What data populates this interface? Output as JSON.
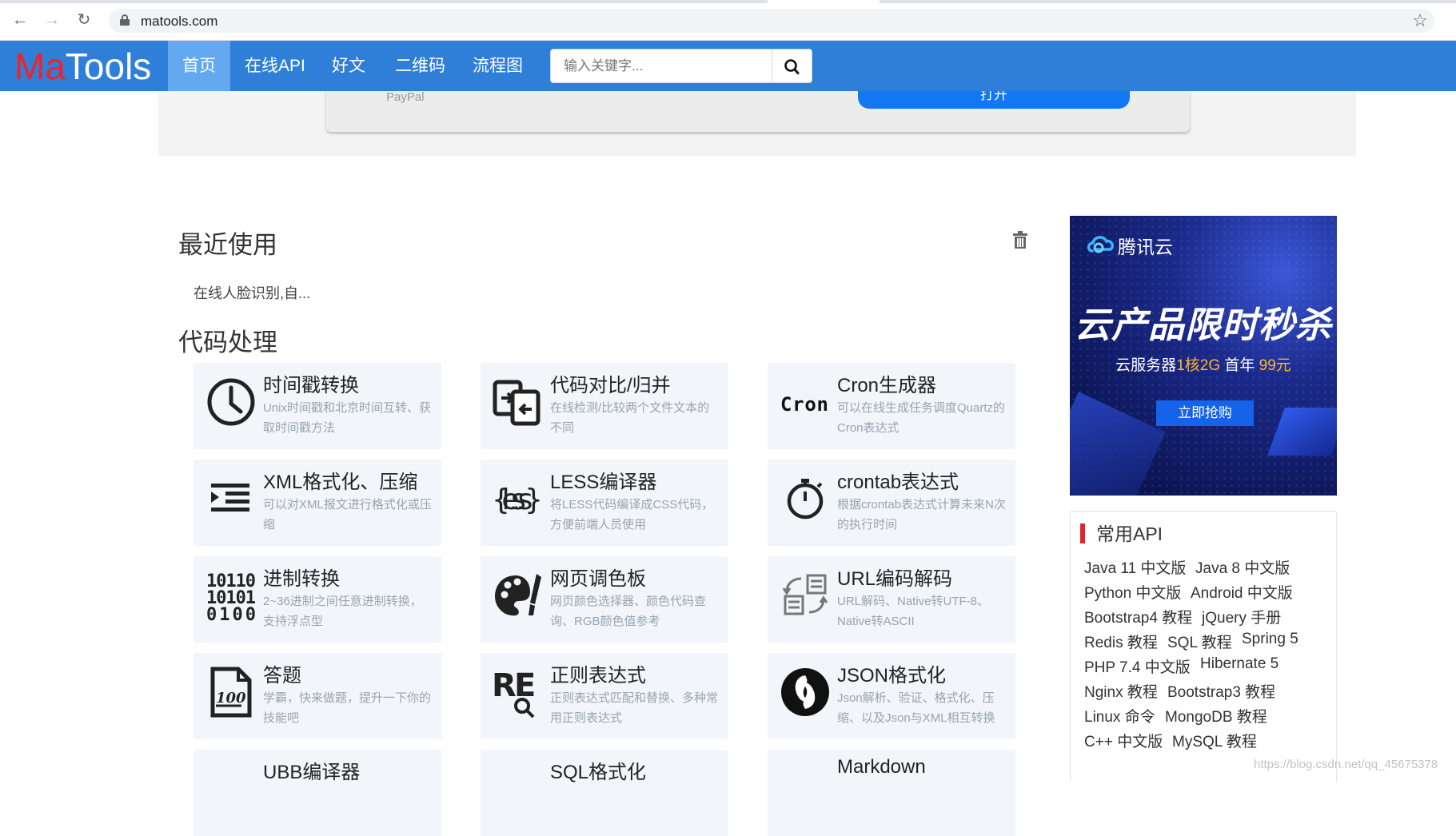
{
  "browser": {
    "url": "matools.com"
  },
  "site": {
    "logo_ma": "Ma",
    "logo_tools": "Tools",
    "nav": [
      "首页",
      "在线API",
      "好文",
      "二维码",
      "流程图"
    ],
    "search_placeholder": "输入关键字..."
  },
  "banner": {
    "caption": "PayPal",
    "button": "打开"
  },
  "recent": {
    "title": "最近使用",
    "items": [
      "在线人脸识别,自..."
    ]
  },
  "code": {
    "title": "代码处理",
    "tools": [
      {
        "title": "时间戳转换",
        "desc": "Unix时间戳和北京时间互转、获取时间戳方法",
        "icon": "clock-icon"
      },
      {
        "title": "代码对比/归并",
        "desc": "在线检测/比较两个文件文本的不同",
        "icon": "code-diff-icon"
      },
      {
        "title": "Cron生成器",
        "desc": "可以在线生成任务调度Quartz的Cron表达式",
        "icon": "cron-icon"
      },
      {
        "title": "XML格式化、压缩",
        "desc": "可以对XML报文进行格式化或压缩",
        "icon": "indent-icon"
      },
      {
        "title": "LESS编译器",
        "desc": "将LESS代码编译成CSS代码，方便前端人员使用",
        "icon": "less-icon"
      },
      {
        "title": "crontab表达式",
        "desc": "根据crontab表达式计算未来N次的执行时间",
        "icon": "stopwatch-icon"
      },
      {
        "title": "进制转换",
        "desc": "2~36进制之间任意进制转换，支持浮点型",
        "icon": "binary-icon"
      },
      {
        "title": "网页调色板",
        "desc": "网页颜色选择器、颜色代码查询、RGB颜色值参考",
        "icon": "palette-icon"
      },
      {
        "title": "URL编码解码",
        "desc": "URL解码、Native转UTF-8、Native转ASCII",
        "icon": "convert-icon"
      },
      {
        "title": "答题",
        "desc": "学霸，快来做题，提升一下你的技能吧",
        "icon": "exam-icon"
      },
      {
        "title": "正则表达式",
        "desc": "正则表达式匹配和替换、多种常用正则表达式",
        "icon": "regex-icon"
      },
      {
        "title": "JSON格式化",
        "desc": "Json解析、验证、格式化、压缩、以及Json与XML相互转换",
        "icon": "json-icon"
      },
      {
        "title": "UBB编译器",
        "desc": "",
        "icon": "ubb-icon"
      },
      {
        "title": "SQL格式化",
        "desc": "",
        "icon": "sql-icon"
      },
      {
        "title": "Markdown",
        "desc": "",
        "icon": "markdown-icon"
      }
    ]
  },
  "ad": {
    "brand": "腾讯云",
    "headline": "云产品限时秒杀",
    "sub_a": "云服务器",
    "sub_hl1": "1核2G",
    "sub_b": " 首年 ",
    "sub_hl2": "99元",
    "button": "立即抢购"
  },
  "api": {
    "title": "常用API",
    "links": [
      [
        "Java 11 中文版",
        "Java 8 中文版"
      ],
      [
        "Python 中文版",
        "Android 中文版"
      ],
      [
        "Bootstrap4 教程",
        "jQuery 手册"
      ],
      [
        "Redis 教程",
        "SQL 教程",
        "Spring 5"
      ],
      [
        "PHP 7.4 中文版",
        "Hibernate 5"
      ],
      [
        "Nginx 教程",
        "Bootstrap3 教程"
      ],
      [
        "Linux 命令",
        "MongoDB 教程"
      ],
      [
        "C++ 中文版",
        "MySQL 教程"
      ]
    ]
  },
  "watermark": "https://blog.csdn.net/qq_45675378",
  "colors": {
    "header": "#2f7fd8",
    "active_nav": "#64a9ef",
    "logo_red": "#e8252b",
    "accent_red": "#e4232b"
  }
}
